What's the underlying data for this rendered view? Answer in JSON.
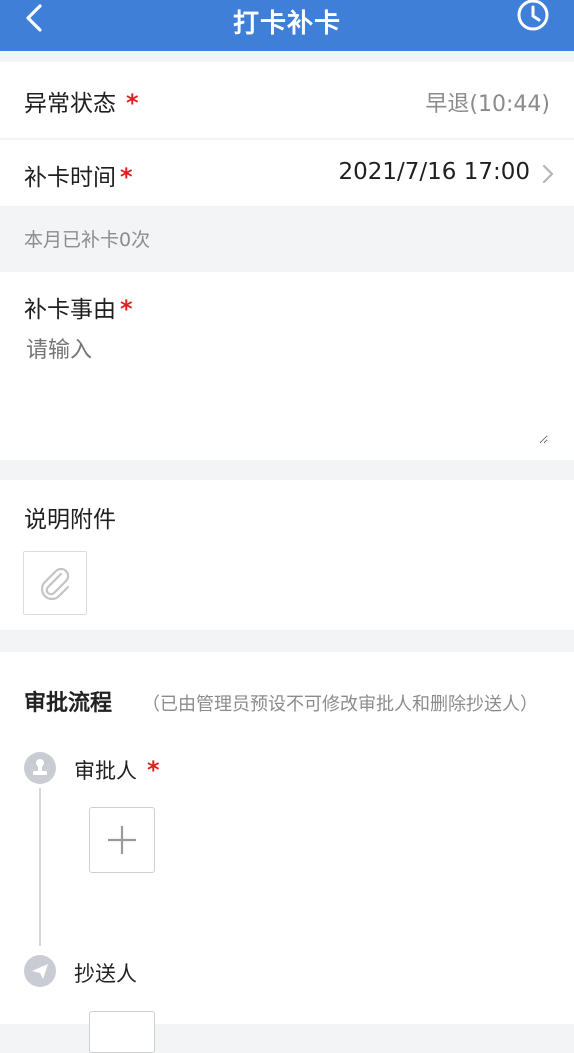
{
  "header": {
    "title": "打卡补卡",
    "back_icon": "chevron-left-icon",
    "history_icon": "history-clock-icon"
  },
  "status_row": {
    "label": "异常状态",
    "required": "*",
    "value": "早退(10:44)"
  },
  "time_row": {
    "label": "补卡时间",
    "required": "*",
    "value": "2021/7/16 17:00"
  },
  "monthly_note": "本月已补卡0次",
  "reason": {
    "label": "补卡事由",
    "required": "*",
    "placeholder": "请输入"
  },
  "attachment": {
    "label": "说明附件",
    "icon": "paperclip-icon"
  },
  "approval": {
    "title": "审批流程",
    "hint": "（已由管理员预设不可修改审批人和删除抄送人）",
    "approver_label": "审批人",
    "approver_required": "*",
    "cc_label": "抄送人",
    "approver_icon": "stamp-icon",
    "cc_icon": "send-icon",
    "add_icon": "plus-icon"
  },
  "colors": {
    "brand": "#3f7fd8",
    "required": "#e02020"
  }
}
